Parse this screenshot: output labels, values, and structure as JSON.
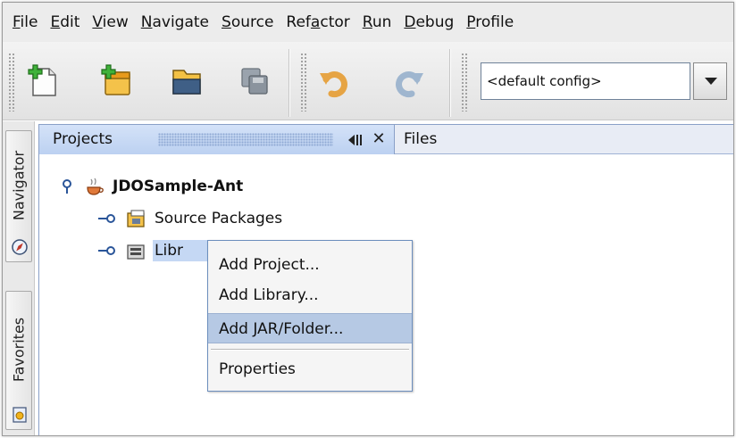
{
  "menubar": {
    "items": [
      {
        "label": "File",
        "mnemonic": "F",
        "rest": "ile",
        "pre": ""
      },
      {
        "label": "Edit",
        "mnemonic": "E",
        "rest": "dit",
        "pre": ""
      },
      {
        "label": "View",
        "mnemonic": "V",
        "rest": "iew",
        "pre": ""
      },
      {
        "label": "Navigate",
        "mnemonic": "N",
        "rest": "avigate",
        "pre": ""
      },
      {
        "label": "Source",
        "mnemonic": "S",
        "rest": "ource",
        "pre": ""
      },
      {
        "label": "Refactor",
        "mnemonic": "a",
        "rest": "ctor",
        "pre": "Ref"
      },
      {
        "label": "Run",
        "mnemonic": "R",
        "rest": "un",
        "pre": ""
      },
      {
        "label": "Debug",
        "mnemonic": "D",
        "rest": "ebug",
        "pre": ""
      },
      {
        "label": "Profile",
        "mnemonic": "P",
        "rest": "rofile",
        "pre": ""
      }
    ]
  },
  "toolbar": {
    "icons": [
      "new-file-icon",
      "new-project-icon",
      "open-project-icon",
      "save-all-icon",
      "undo-icon",
      "redo-icon"
    ],
    "config_select": {
      "value": "<default config>"
    }
  },
  "sidestrip": {
    "navigator_label": "Navigator",
    "favorites_label": "Favorites"
  },
  "panel": {
    "tabs": [
      {
        "label": "Projects",
        "active": true
      },
      {
        "label": "Files",
        "active": false
      }
    ],
    "tree": {
      "project": "JDOSample-Ant",
      "children": [
        {
          "label": "Source Packages"
        },
        {
          "label": "Libraries",
          "visible_text": "Libr"
        }
      ]
    }
  },
  "context_menu": {
    "items": [
      {
        "label": "Add Project..."
      },
      {
        "label": "Add Library..."
      },
      {
        "label": "Add JAR/Folder...",
        "highlighted": true
      },
      {
        "label": "Properties"
      }
    ]
  },
  "colors": {
    "accent": "#c5d8f4",
    "menu_highlight": "#b6c9e4",
    "panel_border": "#8aa0c8"
  }
}
